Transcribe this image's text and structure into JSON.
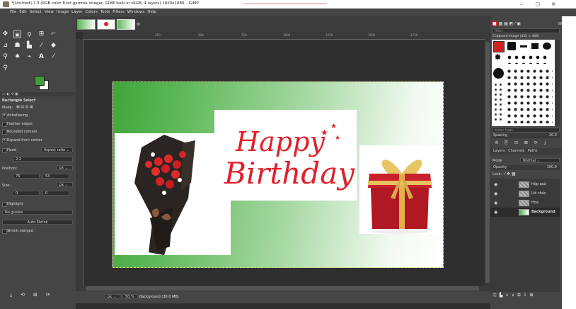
{
  "window": {
    "title": "*[Untitled]-7.0 (RGB color 8-bit gamma integer, GIMP built-in sRGB, 4 layers) 1920x1080 – GIMP",
    "minimize": "–",
    "maximize": "▢",
    "close": "✕"
  },
  "menu": [
    "File",
    "Edit",
    "Select",
    "View",
    "Image",
    "Layer",
    "Colors",
    "Tools",
    "Filters",
    "Windows",
    "Help"
  ],
  "colors": {
    "foreground": "#3e9e38",
    "background": "#ffffff",
    "ui": "#454545"
  },
  "tool_options": {
    "title": "Rectangle Select",
    "mode_label": "Mode:",
    "antialiasing": "Antialiasing",
    "feather_edges": "Feather edges",
    "rounded_corners": "Rounded corners",
    "expand_from_center": "Expand from center",
    "fixed_label": "Fixed",
    "fixed_value": "Aspect ratio",
    "ratio_value": "2:2",
    "position_label": "Position:",
    "position_unit": "px",
    "position_x": "76",
    "position_y": "53",
    "size_label": "Size:",
    "size_unit": "px",
    "size_w": "0",
    "size_h": "0",
    "highlight": "Highlight",
    "guides": "No guides",
    "auto_shrink": "Auto Shrink",
    "shrink_merged": "Shrink merged"
  },
  "ruler": [
    "250",
    "500",
    "750",
    "1000",
    "1250",
    "1500",
    "1750"
  ],
  "image_text": {
    "happy": "Happy",
    "birthday": "Birthday"
  },
  "status": {
    "unit": "px",
    "zoom": "50 %",
    "message": "Background (30.0 MB)"
  },
  "brushes": {
    "filter_placeholder": "filter",
    "current": "Clipboard Image (432 × 468)",
    "tag_placeholder": "enter tags",
    "spacing_label": "Spacing",
    "spacing_value": "20.0"
  },
  "layers_panel": {
    "tabs": [
      "Layers",
      "Channels",
      "Paths"
    ],
    "mode_label": "Mode",
    "mode_value": "Normal",
    "opacity_label": "Opacity",
    "opacity_value": "100.0",
    "lock_label": "Lock:",
    "layers": [
      {
        "name": "Hộp quà",
        "active": false
      },
      {
        "name": "Lời chúc",
        "active": false
      },
      {
        "name": "Hoa",
        "active": false
      },
      {
        "name": "Background",
        "active": true
      }
    ]
  }
}
